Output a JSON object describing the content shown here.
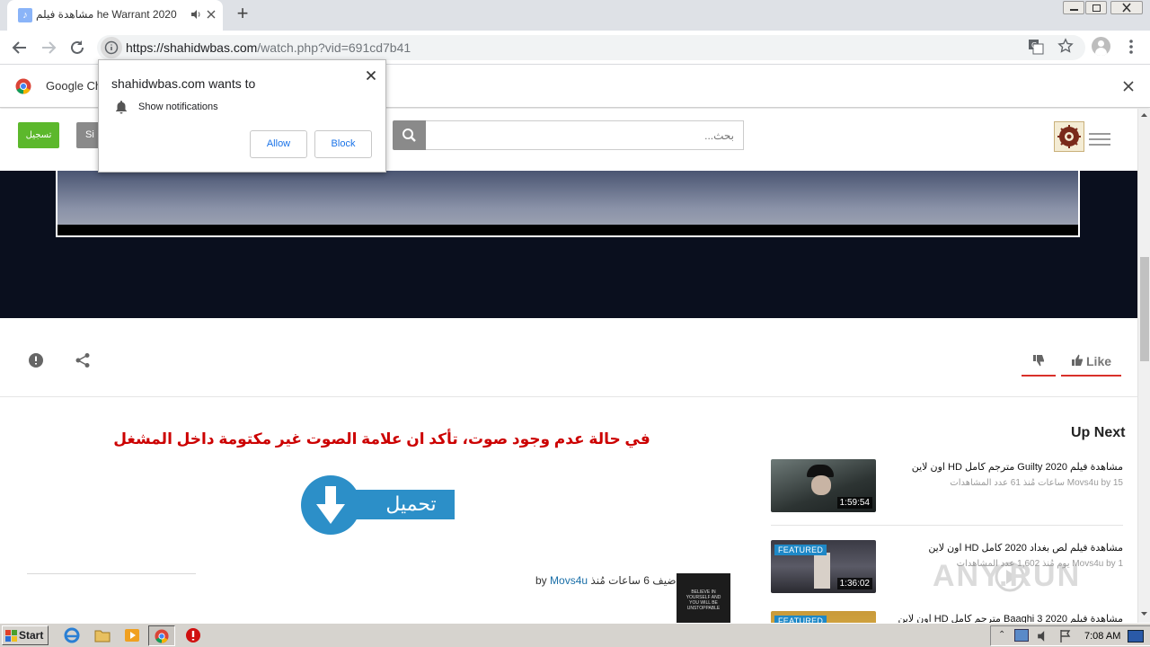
{
  "browser": {
    "tab_title": "he Warrant 2020 مشاهدة فيلم",
    "url_host": "https://shahidwbas.com",
    "url_path": "/watch.php?vid=691cd7b41",
    "infobar_text": "Google Ch",
    "new_tab_label": "+"
  },
  "permission_popup": {
    "title": "shahidwbas.com wants to",
    "item": "Show notifications",
    "allow": "Allow",
    "block": "Block"
  },
  "site": {
    "register_label": "تسجيل",
    "signin_label": "Si",
    "search_placeholder": "بحث..."
  },
  "actions": {
    "like_label": "Like"
  },
  "content": {
    "notice": "في حالة عدم وجود صوت، تأكد ان علامة الصوت غير مكتومة داخل المشغل",
    "download_label": "تحميل",
    "added_text": "أضيف 6 ساعات مُنذ",
    "by_label": "by",
    "author": "Movs4u"
  },
  "up_next": {
    "heading": "Up Next",
    "items": [
      {
        "title": "مشاهدة فيلم Guilty 2020 مترجم كامل HD اون لاين",
        "meta": "15 Movs4u by ساعات مُنذ 61 عدد المشاهدات",
        "duration": "1:59:54",
        "featured": ""
      },
      {
        "title": "مشاهدة فيلم لص بغداد 2020 كامل HD اون لاين",
        "meta": "1 Movs4u by يوم مُنذ 1,602 عدد المشاهدات",
        "duration": "1:36:02",
        "featured": "FEATURED"
      },
      {
        "title": "مشاهدة فيلم Baaghi 3 2020 مترجم كامل HD اون لاين",
        "meta": "",
        "duration": "",
        "featured": "FEATURED"
      }
    ]
  },
  "taskbar": {
    "start_label": "Start",
    "clock": "7:08 AM"
  },
  "watermark": "ANY.RUN",
  "colors": {
    "accent_green": "#5cb82c",
    "notice_red": "#cc0000",
    "like_red": "#d9302a",
    "download_blue": "#2c8fc8"
  }
}
